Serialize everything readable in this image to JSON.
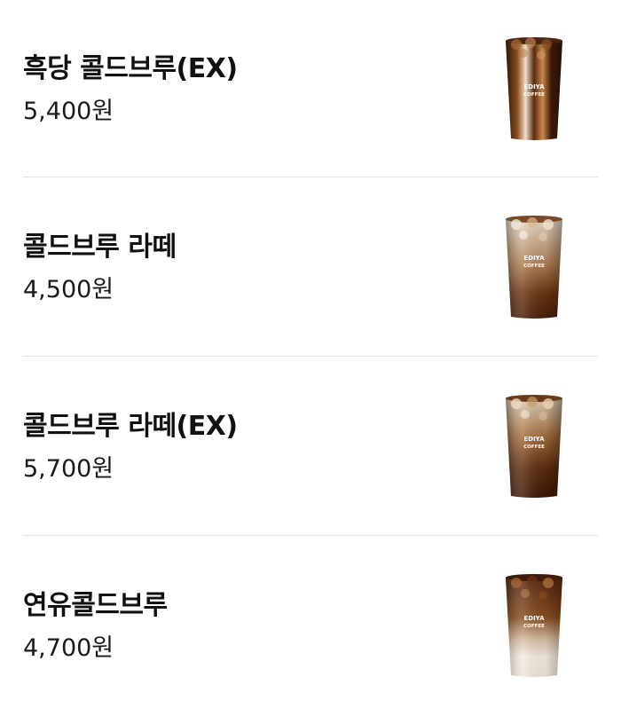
{
  "menu": {
    "items": [
      {
        "name": "흑당 콜드브루(EX)",
        "price": "5,400원",
        "image_icon": "dark-sugar-cold-brew-cup-icon",
        "cup_brand": "EDIYA COFFEE"
      },
      {
        "name": "콜드브루 라떼",
        "price": "4,500원",
        "image_icon": "cold-brew-latte-cup-icon",
        "cup_brand": "EDIYA COFFEE"
      },
      {
        "name": "콜드브루 라떼(EX)",
        "price": "5,700원",
        "image_icon": "cold-brew-latte-ex-cup-icon",
        "cup_brand": "EDIYA COFFEE"
      },
      {
        "name": "연유콜드브루",
        "price": "4,700원",
        "image_icon": "condensed-milk-cold-brew-cup-icon",
        "cup_brand": "EDIYA COFFEE"
      }
    ]
  },
  "colors": {
    "text": "#111111",
    "divider": "#e3e3e3",
    "coffee_dark": "#3b1d0c",
    "coffee_mid": "#7a3f17",
    "milk": "#efe6da"
  }
}
